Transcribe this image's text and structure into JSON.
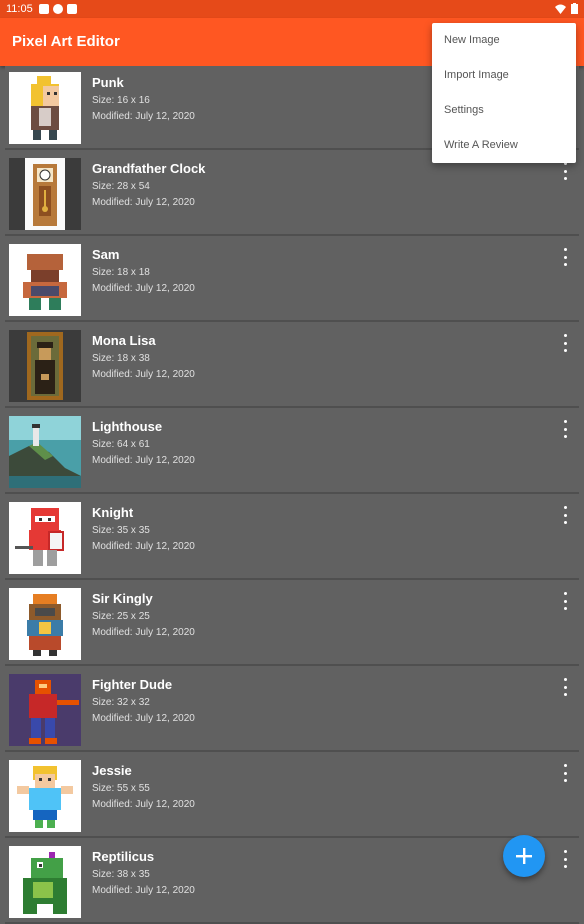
{
  "status_bar": {
    "time": "11:05"
  },
  "app_bar": {
    "title": "Pixel Art Editor"
  },
  "overflow_menu": {
    "items": [
      "New Image",
      "Import Image",
      "Settings",
      "Write A Review"
    ]
  },
  "projects": [
    {
      "name": "Punk",
      "size": "Size: 16 x 16",
      "modified": "Modified: July 12, 2020",
      "thumbnail": "punk-thumbnail"
    },
    {
      "name": "Grandfather Clock",
      "size": "Size: 28 x 54",
      "modified": "Modified: July 12, 2020",
      "thumbnail": "grandfather-clock-thumbnail"
    },
    {
      "name": "Sam",
      "size": "Size: 18 x 18",
      "modified": "Modified: July 12, 2020",
      "thumbnail": "sam-thumbnail"
    },
    {
      "name": "Mona Lisa",
      "size": "Size: 18 x 38",
      "modified": "Modified: July 12, 2020",
      "thumbnail": "mona-lisa-thumbnail"
    },
    {
      "name": "Lighthouse",
      "size": "Size: 64 x 61",
      "modified": "Modified: July 12, 2020",
      "thumbnail": "lighthouse-thumbnail"
    },
    {
      "name": "Knight",
      "size": "Size: 35 x 35",
      "modified": "Modified: July 12, 2020",
      "thumbnail": "knight-thumbnail"
    },
    {
      "name": "Sir Kingly",
      "size": "Size: 25 x 25",
      "modified": "Modified: July 12, 2020",
      "thumbnail": "sir-kingly-thumbnail"
    },
    {
      "name": "Fighter Dude",
      "size": "Size: 32 x 32",
      "modified": "Modified: July 12, 2020",
      "thumbnail": "fighter-dude-thumbnail"
    },
    {
      "name": "Jessie",
      "size": "Size: 55 x 55",
      "modified": "Modified: July 12, 2020",
      "thumbnail": "jessie-thumbnail"
    },
    {
      "name": "Reptilicus",
      "size": "Size: 38 x 35",
      "modified": "Modified: July 12, 2020",
      "thumbnail": "reptilicus-thumbnail"
    }
  ],
  "fab": {
    "icon": "plus-icon"
  },
  "colors": {
    "status_bar": "#e64a19",
    "app_bar": "#ff5722",
    "list_background": "#616161",
    "fab": "#2196f3"
  }
}
